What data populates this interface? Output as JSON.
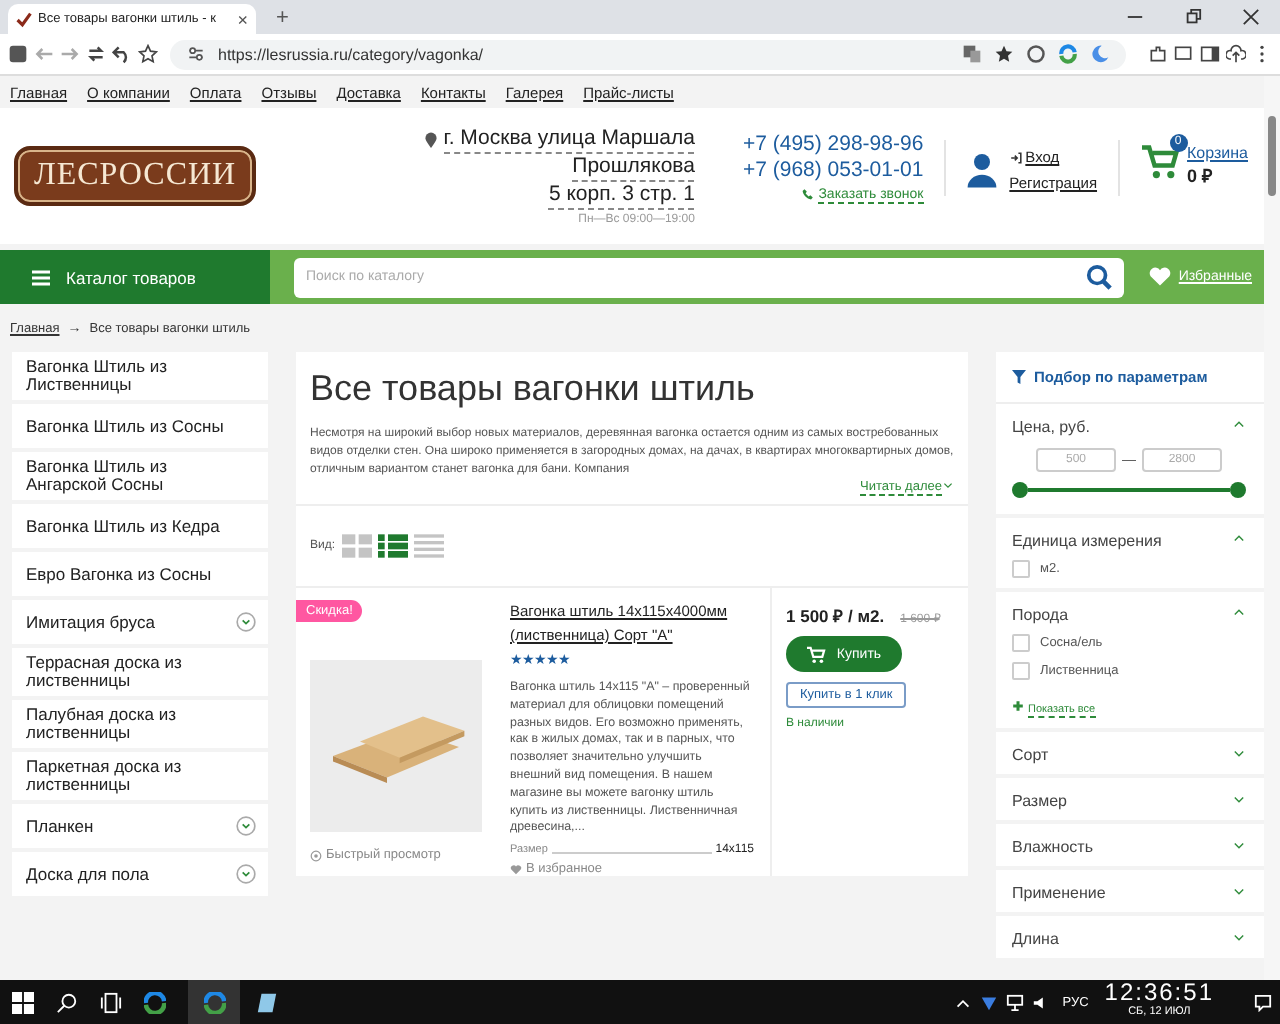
{
  "browser": {
    "tab_title": "Все товары вагонки штиль - к",
    "tab_close": "×",
    "new_tab": "+",
    "url": "https://lesrussia.ru/category/vagonka/"
  },
  "site_nav": [
    "Главная",
    "О компании",
    "Оплата",
    "Отзывы",
    "Доставка",
    "Контакты",
    "Галерея",
    "Прайс-листы"
  ],
  "header": {
    "logo": "ЛЕСРОССИИ",
    "address": [
      "г. Москва улица Маршала",
      "Прошлякова",
      "5 корп. 3 стр. 1"
    ],
    "hours": "Пн—Вс 09:00—19:00",
    "phones": [
      "+7 (495) 298-98-96",
      "+7 (968) 053-01-01"
    ],
    "callback": "Заказать звонок",
    "login": "Вход",
    "register": "Регистрация",
    "cart_count": "0",
    "cart_label": "Корзина",
    "cart_total": "0 ₽"
  },
  "catalog_button": "Каталог товаров",
  "search": {
    "placeholder": "Поиск по каталогу"
  },
  "favorites": "Избранные",
  "breadcrumb": {
    "items": [
      "Главная",
      "Все товары вагонки штиль"
    ],
    "separator": "→"
  },
  "sidebar": [
    {
      "label": "Вагонка Штиль из Лиственницы",
      "has_children": false
    },
    {
      "label": "Вагонка Штиль из Сосны",
      "has_children": false
    },
    {
      "label": "Вагонка Штиль из Ангарской Сосны",
      "has_children": false
    },
    {
      "label": "Вагонка Штиль из Кедра",
      "has_children": false
    },
    {
      "label": "Евро Вагонка из Сосны",
      "has_children": false
    },
    {
      "label": "Имитация бруса",
      "has_children": true
    },
    {
      "label": "Террасная доска из лиственницы",
      "has_children": false
    },
    {
      "label": "Палубная доска из лиственницы",
      "has_children": false
    },
    {
      "label": "Паркетная доска из лиственницы",
      "has_children": false
    },
    {
      "label": "Планкен",
      "has_children": true
    },
    {
      "label": "Доска для пола",
      "has_children": true
    }
  ],
  "page": {
    "title": "Все товары вагонки штиль",
    "intro": "Несмотря на широкий выбор новых материалов, деревянная вагонка остается одним из самых востребованных видов отделки стен. Она широко применяется в загородных домах, на дачах, в квартирах многоквартирных домов, отличным вариантом станет вагонка для бани. Компания",
    "read_more": "Читать далее",
    "view_label": "Вид:",
    "views": [
      {
        "kind": "grid",
        "selected": false
      },
      {
        "kind": "list",
        "selected": true
      },
      {
        "kind": "table",
        "selected": false
      }
    ]
  },
  "product": {
    "badge": "Скидка!",
    "title": "Вагонка штиль 14x115x4000мм (лиственница) Сорт \"A\"",
    "stars": 5,
    "description": "Вагонка штиль 14x115 \"A\" – проверенный материал для облицовки помещений разных видов. Его возможно применять, как в жилых домах, так и в парных, что позволяет значительно улучшить внешний вид помещения. В нашем магазине вы можете вагонку штиль купить из лиственницы. Лиственничная древесина,...",
    "size_label": "Размер",
    "size_value": "14x115",
    "quick_view": "Быстрый просмотр",
    "to_favorites": "В избранное",
    "price": "1 500 ₽ / м2.",
    "old_price": "1 600 ₽",
    "buy": "Купить",
    "one_click": "Купить в 1 клик",
    "stock": "В наличии"
  },
  "filters": {
    "title": "Подбор по параметрам",
    "sections": [
      {
        "kind": "range",
        "label": "Цена, руб.",
        "expanded": true,
        "min": "500",
        "max": "2800",
        "separator": "—"
      },
      {
        "kind": "checks",
        "label": "Единица измерения",
        "expanded": true,
        "options": [
          {
            "label": "м2.",
            "checked": false
          }
        ]
      },
      {
        "kind": "checks",
        "label": "Порода",
        "expanded": true,
        "options": [
          {
            "label": "Сосна/ель",
            "checked": false
          },
          {
            "label": "Лиственница",
            "checked": false
          }
        ],
        "show_all": "Показать все"
      },
      {
        "kind": "checks",
        "label": "Сорт",
        "expanded": false
      },
      {
        "kind": "checks",
        "label": "Размер",
        "expanded": false
      },
      {
        "kind": "checks",
        "label": "Влажность",
        "expanded": false
      },
      {
        "kind": "checks",
        "label": "Применение",
        "expanded": false
      },
      {
        "kind": "checks",
        "label": "Длина",
        "expanded": false
      }
    ]
  },
  "taskbar": {
    "language": "РУС",
    "time": "12:36:51",
    "date": "СБ, 12 ИЮЛ"
  }
}
